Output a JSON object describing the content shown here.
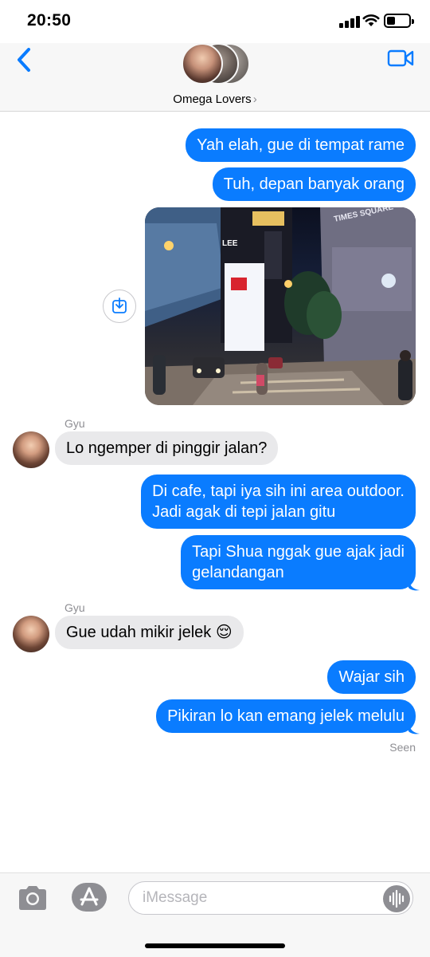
{
  "status_bar": {
    "time": "20:50"
  },
  "header": {
    "group_name": "Omega Lovers",
    "chevron": "›"
  },
  "messages": [
    {
      "text": "Yah elah, gue di tempat rame"
    },
    {
      "text": "Tuh, depan banyak orang"
    },
    {
      "sender": "Gyu",
      "text": "Lo ngemper di pinggir jalan?"
    },
    {
      "line1": "Di cafe, tapi iya sih ini area outdoor.",
      "line2": "Jadi agak di tepi jalan gitu"
    },
    {
      "line1": "Tapi Shua nggak gue ajak jadi",
      "line2": "gelandangan"
    },
    {
      "sender": "Gyu",
      "text": "Gue udah mikir jelek 😌"
    },
    {
      "text": "Wajar sih"
    },
    {
      "text": "Pikiran lo kan emang jelek melulu"
    }
  ],
  "status": {
    "seen": "Seen"
  },
  "photo": {
    "signs": [
      "LEE",
      "TIMES SQUARE"
    ]
  },
  "input": {
    "placeholder": "iMessage"
  },
  "colors": {
    "outgoing": "#0a7cff",
    "incoming": "#e9e9eb",
    "accent": "#0a7cff"
  },
  "icons": [
    "back-chevron-icon",
    "video-call-icon",
    "save-image-icon",
    "camera-icon",
    "app-store-icon",
    "audio-waveform-icon"
  ]
}
